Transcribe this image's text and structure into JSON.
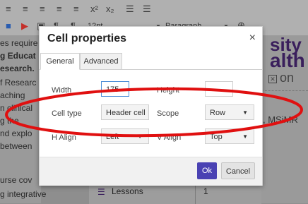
{
  "toolbar": {
    "font_size": "12pt",
    "block_format": "Paragraph"
  },
  "background_left": {
    "lines": [
      "es require",
      "g Educat",
      "esearch.",
      "f Researc",
      "aching",
      "n clinical",
      "g the",
      "nd explo",
      "between",
      "urse cov",
      "g integrative"
    ]
  },
  "background_right": {
    "brand_line1": "sity",
    "brand_line2": "alth",
    "on_text": "on",
    "box_glyph": "✕",
    "degree_text": ", MSiMR"
  },
  "lessons": {
    "label": "Lessons",
    "number": "1"
  },
  "dialog": {
    "title": "Cell properties",
    "close_glyph": "×",
    "tabs": [
      "General",
      "Advanced"
    ],
    "width_label": "Width",
    "width_value": "175",
    "height_label": "Height",
    "height_value": "",
    "cell_type_label": "Cell type",
    "cell_type_value": "Header cell",
    "scope_label": "Scope",
    "scope_value": "Row",
    "h_align_label": "H Align",
    "h_align_value": "Left",
    "v_align_label": "V Align",
    "v_align_value": "Top",
    "ok_label": "Ok",
    "cancel_label": "Cancel"
  },
  "annotation": {
    "color": "#e01010"
  }
}
